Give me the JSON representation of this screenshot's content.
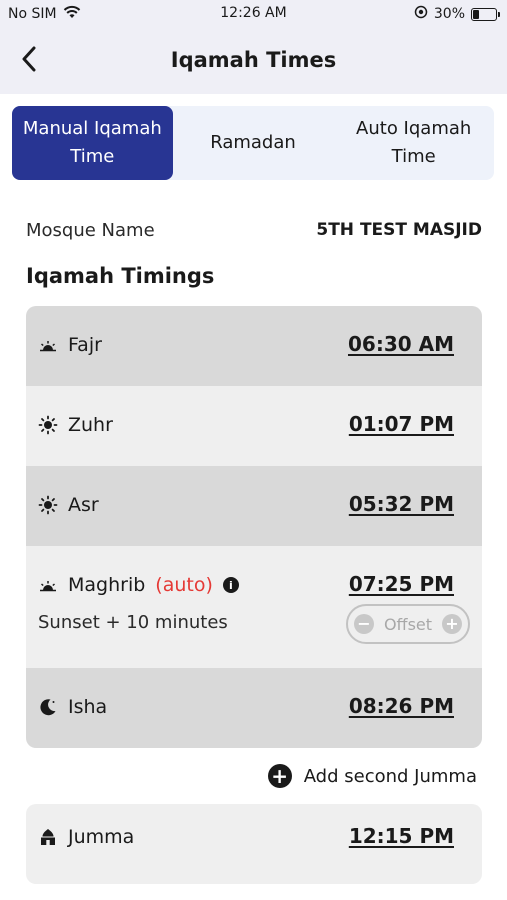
{
  "status_bar": {
    "carrier": "No SIM",
    "time": "12:26 AM",
    "battery": "30%",
    "battery_level": 0.3
  },
  "header": {
    "title": "Iqamah Times",
    "back_icon": "chevron-left-icon"
  },
  "tabs": [
    {
      "label": "Manual Iqamah Time",
      "active": true
    },
    {
      "label": "Ramadan",
      "active": false
    },
    {
      "label": "Auto Iqamah Time",
      "active": false
    }
  ],
  "mosque": {
    "label": "Mosque Name",
    "value": "5TH TEST MASJID"
  },
  "section_title": "Iqamah Timings",
  "prayers": {
    "fajr": {
      "name": "Fajr",
      "time": "06:30 AM",
      "icon": "sunrise-icon"
    },
    "zuhr": {
      "name": "Zuhr",
      "time": "01:07 PM",
      "icon": "sun-icon"
    },
    "asr": {
      "name": "Asr",
      "time": "05:32 PM",
      "icon": "sun-icon"
    },
    "maghrib": {
      "name": "Maghrib",
      "auto_label": "(auto)",
      "time": "07:25 PM",
      "icon": "sunset-icon",
      "sunset_text": "Sunset + 10 minutes",
      "offset_label": "Offset"
    },
    "isha": {
      "name": "Isha",
      "time": "08:26 PM",
      "icon": "moon-icon"
    }
  },
  "add_jumma_label": "Add second Jumma",
  "jumma": {
    "name": "Jumma",
    "time": "12:15 PM",
    "icon": "mosque-icon"
  },
  "colors": {
    "accent": "#283593",
    "auto": "#e53935",
    "row_dark": "#d9d9d9",
    "row_light": "#efefef"
  }
}
